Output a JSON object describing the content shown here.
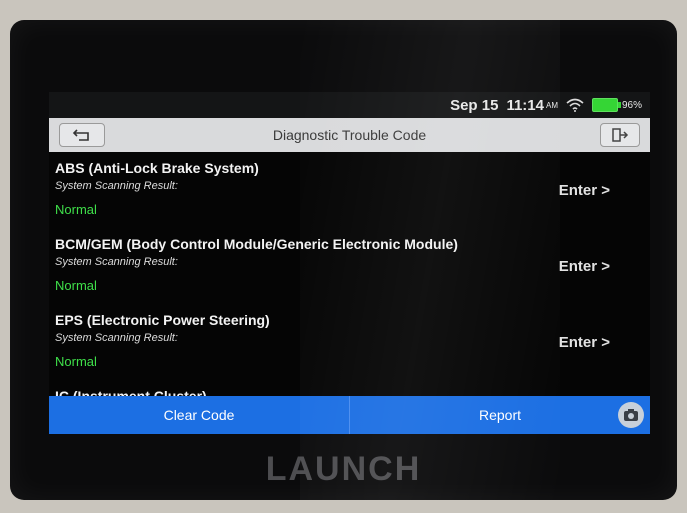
{
  "status_bar": {
    "date": "Sep 15",
    "time": "11:14",
    "ampm": "AM",
    "battery": "96%"
  },
  "header": {
    "title": "Diagnostic Trouble Code"
  },
  "items": [
    {
      "name": "ABS (Anti-Lock Brake System)",
      "subtitle": "System Scanning Result:",
      "status": "Normal",
      "action": "Enter >"
    },
    {
      "name": "BCM/GEM (Body Control Module/Generic Electronic Module)",
      "subtitle": "System Scanning Result:",
      "status": "Normal",
      "action": "Enter >"
    },
    {
      "name": "EPS (Electronic Power Steering)",
      "subtitle": "System Scanning Result:",
      "status": "Normal",
      "action": "Enter >"
    },
    {
      "name": "IC (Instrument Cluster)"
    }
  ],
  "footer": {
    "clear_label": "Clear Code",
    "report_label": "Report"
  },
  "brand": "LAUNCH",
  "colors": {
    "status_normal": "#3fe04a",
    "action_bar": "#1c6fe3",
    "battery": "#35d535"
  }
}
